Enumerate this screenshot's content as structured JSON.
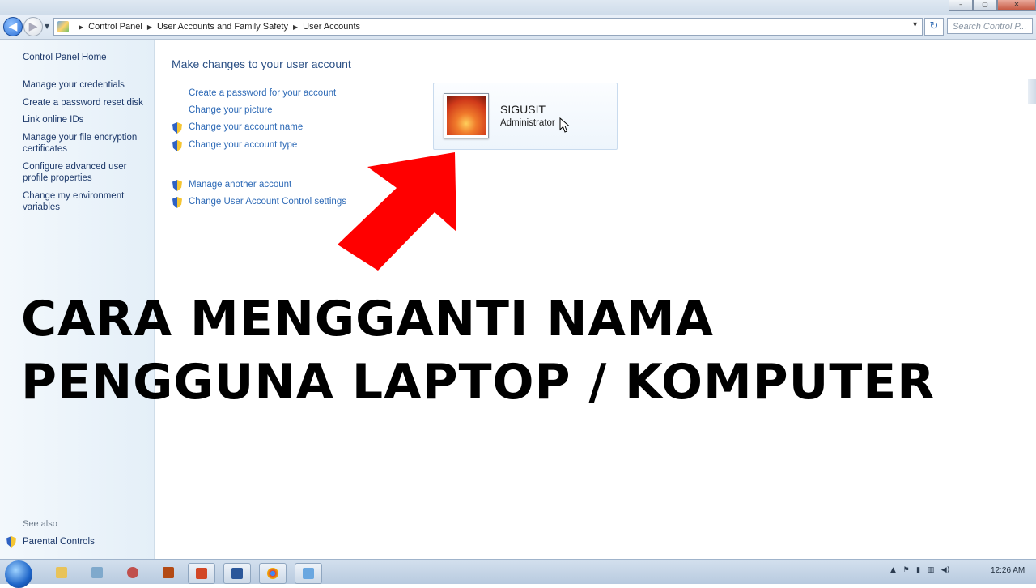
{
  "window": {
    "minimize_label": "–",
    "maximize_label": "▢",
    "close_label": "✕"
  },
  "address": {
    "back_icon": "◀",
    "forward_icon": "▶",
    "crumbs": [
      "Control Panel",
      "User Accounts and Family Safety",
      "User Accounts"
    ],
    "search_placeholder": "Search Control P..."
  },
  "sidebar": {
    "items": [
      "Control Panel Home",
      "Manage your credentials",
      "Create a password reset disk",
      "Link online IDs",
      "Manage your file encryption certificates",
      "Configure advanced user profile properties",
      "Change my environment variables"
    ],
    "see_also_label": "See also",
    "see_also_items": [
      "Parental Controls"
    ]
  },
  "main": {
    "heading": "Make changes to your user account",
    "tasks": [
      "Create a password for your account",
      "Change your picture",
      "Change your account name",
      "Change your account type"
    ],
    "other_tasks": [
      "Manage another account",
      "Change User Account Control settings"
    ]
  },
  "account": {
    "name": "SIGUSIT",
    "type": "Administrator"
  },
  "overlay": {
    "line1": "CARA MENGGANTI NAMA",
    "line2": "PENGGUNA LAPTOP / KOMPUTER",
    "arrow_color": "#ff0000"
  },
  "taskbar": {
    "clock": "12:26 AM",
    "apps": [
      "explorer-icon",
      "media-icon",
      "paint-icon",
      "app-icon",
      "powerpoint-icon",
      "word-icon",
      "chrome-icon",
      "control-panel-icon"
    ]
  }
}
